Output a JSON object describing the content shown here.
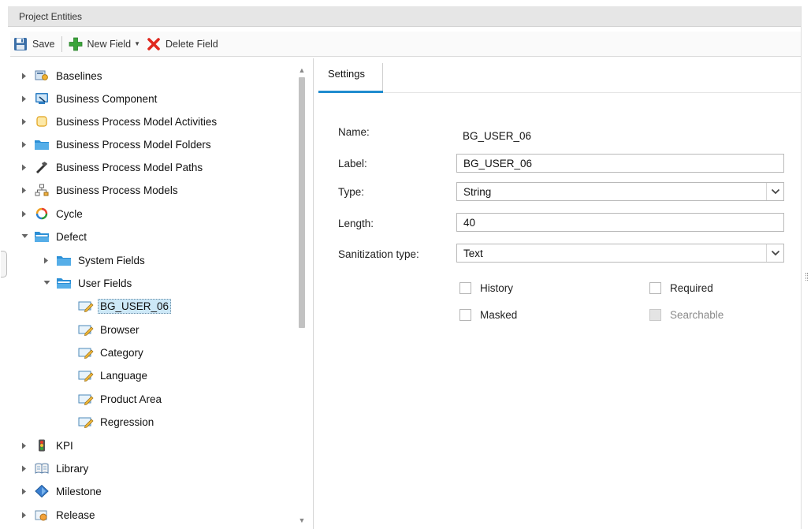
{
  "header": {
    "title": "Project Entities"
  },
  "toolbar": {
    "save_label": "Save",
    "new_field_label": "New Field",
    "delete_field_label": "Delete Field"
  },
  "tree": {
    "items": [
      {
        "label": "Baselines",
        "icon": "baselines-icon"
      },
      {
        "label": "Business Component",
        "icon": "business-component-icon"
      },
      {
        "label": "Business Process Model Activities",
        "icon": "activity-icon"
      },
      {
        "label": "Business Process Model Folders",
        "icon": "folder-icon"
      },
      {
        "label": "Business Process Model Paths",
        "icon": "path-icon"
      },
      {
        "label": "Business Process Models",
        "icon": "process-model-icon"
      },
      {
        "label": "Cycle",
        "icon": "cycle-icon"
      },
      {
        "label": "Defect",
        "icon": "folder-open-icon"
      },
      {
        "label": "System Fields",
        "icon": "folder-icon"
      },
      {
        "label": "User Fields",
        "icon": "folder-open-icon"
      },
      {
        "label": "BG_USER_06",
        "icon": "field-icon"
      },
      {
        "label": "Browser",
        "icon": "field-icon"
      },
      {
        "label": "Category",
        "icon": "field-icon"
      },
      {
        "label": "Language",
        "icon": "field-icon"
      },
      {
        "label": "Product Area",
        "icon": "field-icon"
      },
      {
        "label": "Regression",
        "icon": "field-icon"
      },
      {
        "label": "KPI",
        "icon": "kpi-icon"
      },
      {
        "label": "Library",
        "icon": "library-icon"
      },
      {
        "label": "Milestone",
        "icon": "milestone-icon"
      },
      {
        "label": "Release",
        "icon": "release-icon"
      }
    ]
  },
  "settings": {
    "tab_label": "Settings",
    "name_label": "Name:",
    "name_value": "BG_USER_06",
    "label_label": "Label:",
    "label_value": "BG_USER_06",
    "type_label": "Type:",
    "type_value": "String",
    "length_label": "Length:",
    "length_value": "40",
    "sanitization_label": "Sanitization type:",
    "sanitization_value": "Text",
    "history_label": "History",
    "required_label": "Required",
    "masked_label": "Masked",
    "searchable_label": "Searchable"
  },
  "colors": {
    "accent": "#1f8ccf",
    "selection": "#cde8f7",
    "delete": "#e0281e",
    "add": "#3aa53a"
  }
}
